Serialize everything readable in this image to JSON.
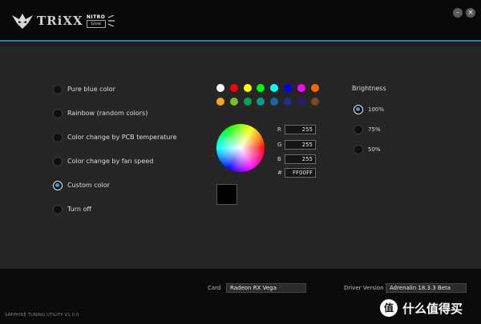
{
  "header": {
    "logo_text": "TRiXX",
    "nitro_label": "NITRO",
    "nitro_sub": "Glow",
    "minimize_glyph": "–",
    "close_glyph": "×"
  },
  "options": [
    {
      "label": "Pure blue color",
      "selected": false
    },
    {
      "label": "Rainbow (random colors)",
      "selected": false
    },
    {
      "label": "Color change by PCB temperature",
      "selected": false
    },
    {
      "label": "Color change by fan speed",
      "selected": false
    },
    {
      "label": "Custom color",
      "selected": true
    },
    {
      "label": "Turn off",
      "selected": false
    }
  ],
  "swatches": [
    "#ffffff",
    "#ff0000",
    "#ffff00",
    "#00ff00",
    "#00ffff",
    "#0000ff",
    "#ff00ff",
    "#ff6a00",
    "#f7a325",
    "#7cbf2c",
    "#0aa35a",
    "#0a9b8c",
    "#1a67a8",
    "#1f2f8f",
    "#2a1d6e",
    "#7a4a1e"
  ],
  "rgb": {
    "r_label": "R",
    "r_value": "255",
    "g_label": "G",
    "g_value": "255",
    "b_label": "B",
    "b_value": "255",
    "hex_label": "#",
    "hex_value": "FF00FF"
  },
  "brightness": {
    "title": "Brightness",
    "levels": [
      {
        "label": "100%",
        "selected": true
      },
      {
        "label": "75%",
        "selected": false
      },
      {
        "label": "50%",
        "selected": false
      }
    ]
  },
  "footer": {
    "card_label": "Card",
    "card_value": "Radeon RX Vega",
    "driver_label": "Driver Version",
    "driver_value": "Adrenalin 18.3.3 Beta",
    "version": "SAPPHIRE TUNING UTILITY V1.0.0"
  },
  "watermark": {
    "icon_text": "值",
    "text": "什么值得买"
  },
  "colors": {
    "accent": "#2c7fb0",
    "selected_dot": "#2ea0e0",
    "preview": "#000000"
  }
}
